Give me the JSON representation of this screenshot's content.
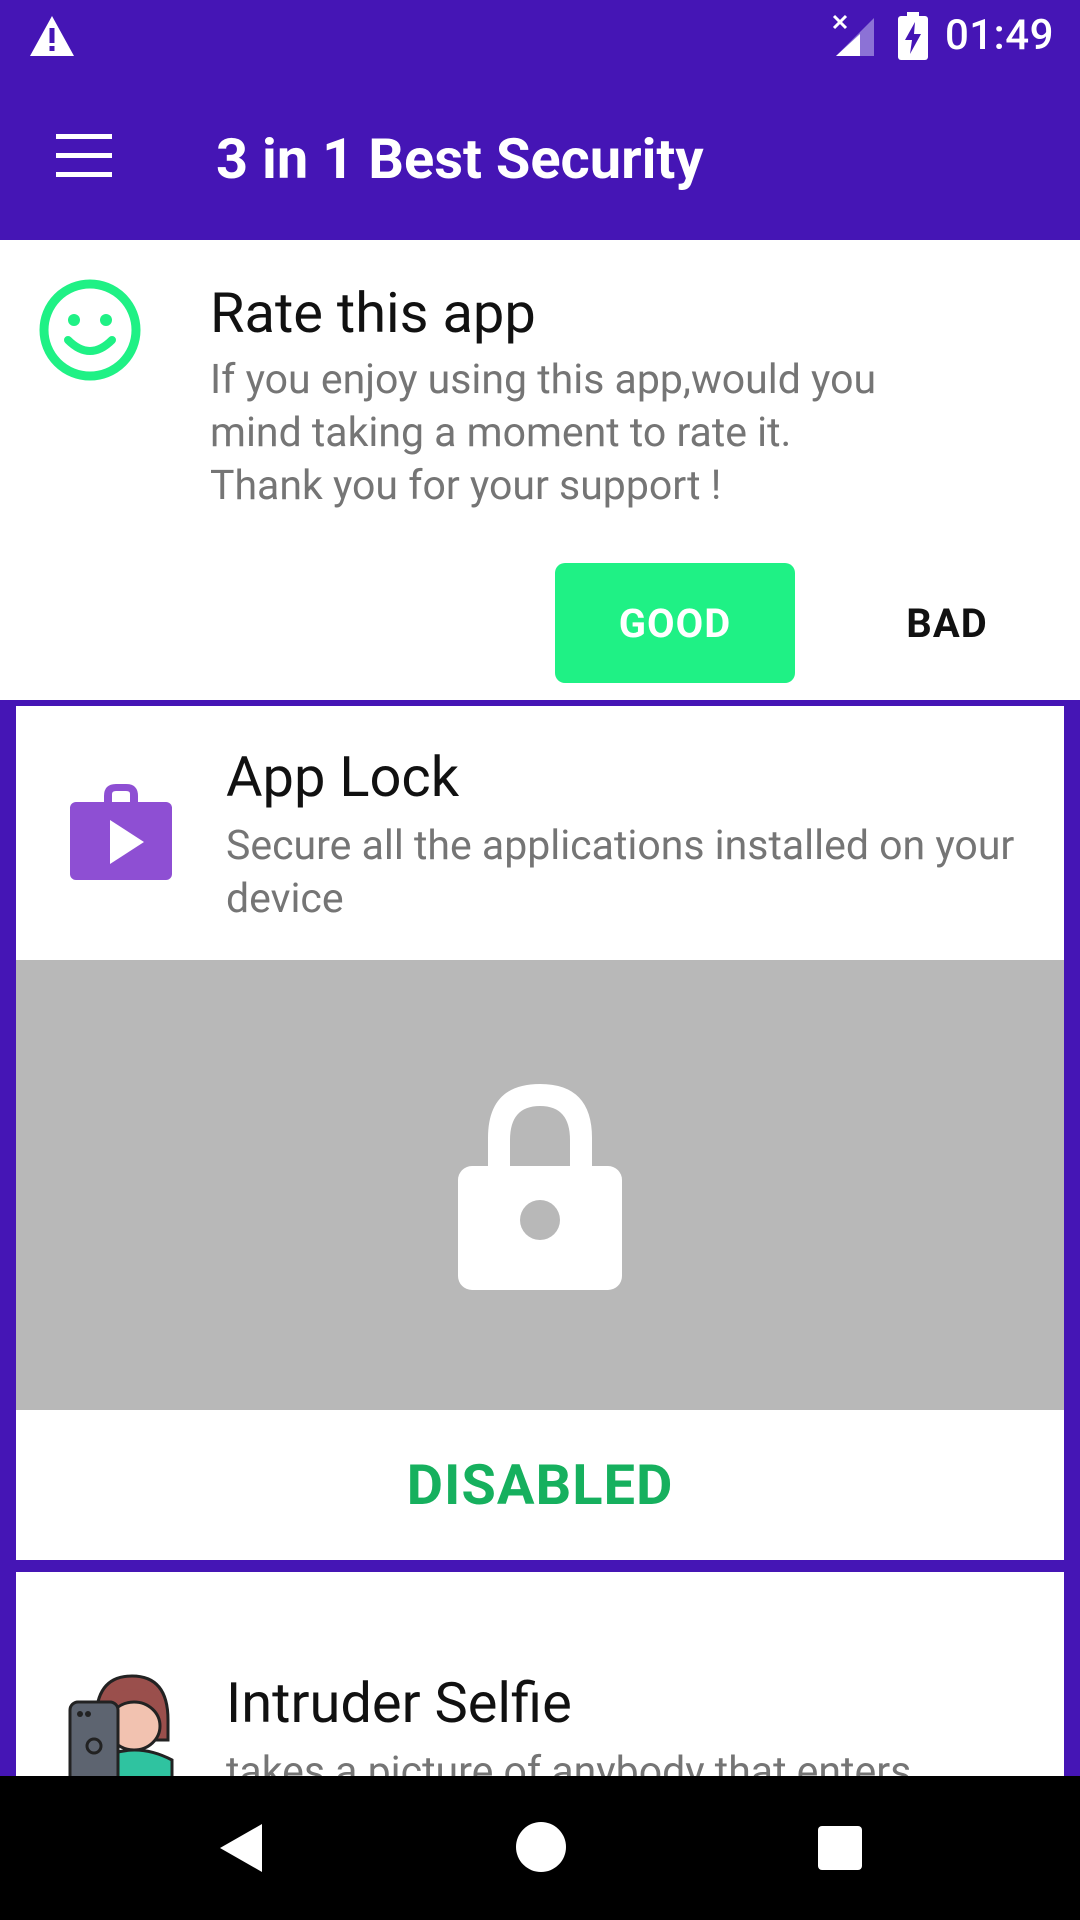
{
  "status_bar": {
    "time": "01:49",
    "icons": [
      "warning-icon",
      "signal-icon",
      "battery-charging-icon"
    ]
  },
  "toolbar": {
    "title": "3 in 1 Best Security",
    "menu_icon": "hamburger-menu-icon"
  },
  "rate_card": {
    "icon": "smiley-icon",
    "title": "Rate this app",
    "lines": [
      "If you enjoy using this app,would you",
      "mind taking a moment to rate it.",
      "Thank you for your support !"
    ],
    "good_label": "GOOD",
    "bad_label": "BAD"
  },
  "app_lock": {
    "icon": "app-lock-icon",
    "title": "App Lock",
    "description": "Secure all the applications installed on your device",
    "status": "DISABLED",
    "status_color": "#16b05e"
  },
  "intruder_selfie": {
    "icon": "intruder-selfie-icon",
    "title": "Intruder Selfie",
    "description": "takes a picture of anybody that enters"
  },
  "colors": {
    "primary": "#4515b5",
    "accent": "#1ff185",
    "lock_area": "#b8b8b8"
  }
}
